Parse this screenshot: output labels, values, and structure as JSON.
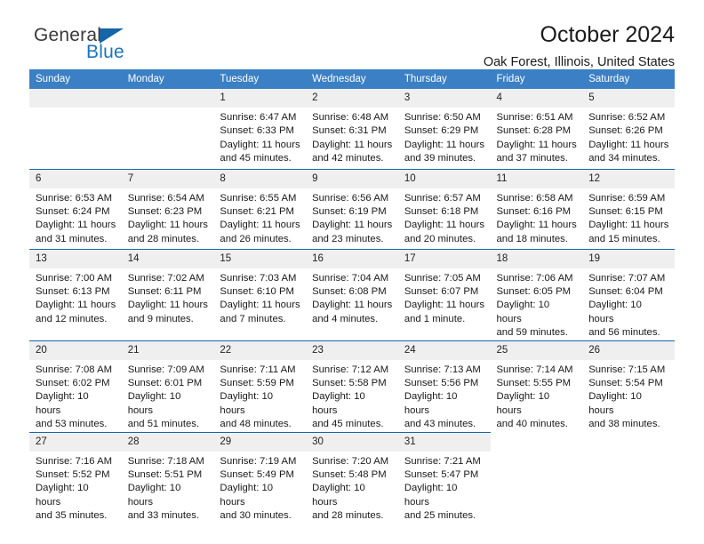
{
  "brand": {
    "name_part1": "General",
    "name_part2": "Blue",
    "triangle_color": "#1565a8",
    "blue_color": "#1b75bb"
  },
  "header": {
    "title": "October 2024",
    "subtitle": "Oak Forest, Illinois, United States"
  },
  "theme": {
    "header_row_bg": "#3b7fc4",
    "row_divider": "#1565a8",
    "daynum_bg": "#efefef"
  },
  "weekday_headers": [
    "Sunday",
    "Monday",
    "Tuesday",
    "Wednesday",
    "Thursday",
    "Friday",
    "Saturday"
  ],
  "labels": {
    "sunrise_prefix": "Sunrise:",
    "sunset_prefix": "Sunset:",
    "daylight_prefix": "Daylight:"
  },
  "weeks": [
    [
      {
        "day": "",
        "lines": []
      },
      {
        "day": "",
        "lines": []
      },
      {
        "day": "1",
        "lines": [
          "Sunrise: 6:47 AM",
          "Sunset: 6:33 PM",
          "Daylight: 11 hours",
          "and 45 minutes."
        ]
      },
      {
        "day": "2",
        "lines": [
          "Sunrise: 6:48 AM",
          "Sunset: 6:31 PM",
          "Daylight: 11 hours",
          "and 42 minutes."
        ]
      },
      {
        "day": "3",
        "lines": [
          "Sunrise: 6:50 AM",
          "Sunset: 6:29 PM",
          "Daylight: 11 hours",
          "and 39 minutes."
        ]
      },
      {
        "day": "4",
        "lines": [
          "Sunrise: 6:51 AM",
          "Sunset: 6:28 PM",
          "Daylight: 11 hours",
          "and 37 minutes."
        ]
      },
      {
        "day": "5",
        "lines": [
          "Sunrise: 6:52 AM",
          "Sunset: 6:26 PM",
          "Daylight: 11 hours",
          "and 34 minutes."
        ]
      }
    ],
    [
      {
        "day": "6",
        "lines": [
          "Sunrise: 6:53 AM",
          "Sunset: 6:24 PM",
          "Daylight: 11 hours",
          "and 31 minutes."
        ]
      },
      {
        "day": "7",
        "lines": [
          "Sunrise: 6:54 AM",
          "Sunset: 6:23 PM",
          "Daylight: 11 hours",
          "and 28 minutes."
        ]
      },
      {
        "day": "8",
        "lines": [
          "Sunrise: 6:55 AM",
          "Sunset: 6:21 PM",
          "Daylight: 11 hours",
          "and 26 minutes."
        ]
      },
      {
        "day": "9",
        "lines": [
          "Sunrise: 6:56 AM",
          "Sunset: 6:19 PM",
          "Daylight: 11 hours",
          "and 23 minutes."
        ]
      },
      {
        "day": "10",
        "lines": [
          "Sunrise: 6:57 AM",
          "Sunset: 6:18 PM",
          "Daylight: 11 hours",
          "and 20 minutes."
        ]
      },
      {
        "day": "11",
        "lines": [
          "Sunrise: 6:58 AM",
          "Sunset: 6:16 PM",
          "Daylight: 11 hours",
          "and 18 minutes."
        ]
      },
      {
        "day": "12",
        "lines": [
          "Sunrise: 6:59 AM",
          "Sunset: 6:15 PM",
          "Daylight: 11 hours",
          "and 15 minutes."
        ]
      }
    ],
    [
      {
        "day": "13",
        "lines": [
          "Sunrise: 7:00 AM",
          "Sunset: 6:13 PM",
          "Daylight: 11 hours",
          "and 12 minutes."
        ]
      },
      {
        "day": "14",
        "lines": [
          "Sunrise: 7:02 AM",
          "Sunset: 6:11 PM",
          "Daylight: 11 hours",
          "and 9 minutes."
        ]
      },
      {
        "day": "15",
        "lines": [
          "Sunrise: 7:03 AM",
          "Sunset: 6:10 PM",
          "Daylight: 11 hours",
          "and 7 minutes."
        ]
      },
      {
        "day": "16",
        "lines": [
          "Sunrise: 7:04 AM",
          "Sunset: 6:08 PM",
          "Daylight: 11 hours",
          "and 4 minutes."
        ]
      },
      {
        "day": "17",
        "lines": [
          "Sunrise: 7:05 AM",
          "Sunset: 6:07 PM",
          "Daylight: 11 hours",
          "and 1 minute."
        ]
      },
      {
        "day": "18",
        "lines": [
          "Sunrise: 7:06 AM",
          "Sunset: 6:05 PM",
          "Daylight: 10 hours",
          "and 59 minutes."
        ]
      },
      {
        "day": "19",
        "lines": [
          "Sunrise: 7:07 AM",
          "Sunset: 6:04 PM",
          "Daylight: 10 hours",
          "and 56 minutes."
        ]
      }
    ],
    [
      {
        "day": "20",
        "lines": [
          "Sunrise: 7:08 AM",
          "Sunset: 6:02 PM",
          "Daylight: 10 hours",
          "and 53 minutes."
        ]
      },
      {
        "day": "21",
        "lines": [
          "Sunrise: 7:09 AM",
          "Sunset: 6:01 PM",
          "Daylight: 10 hours",
          "and 51 minutes."
        ]
      },
      {
        "day": "22",
        "lines": [
          "Sunrise: 7:11 AM",
          "Sunset: 5:59 PM",
          "Daylight: 10 hours",
          "and 48 minutes."
        ]
      },
      {
        "day": "23",
        "lines": [
          "Sunrise: 7:12 AM",
          "Sunset: 5:58 PM",
          "Daylight: 10 hours",
          "and 45 minutes."
        ]
      },
      {
        "day": "24",
        "lines": [
          "Sunrise: 7:13 AM",
          "Sunset: 5:56 PM",
          "Daylight: 10 hours",
          "and 43 minutes."
        ]
      },
      {
        "day": "25",
        "lines": [
          "Sunrise: 7:14 AM",
          "Sunset: 5:55 PM",
          "Daylight: 10 hours",
          "and 40 minutes."
        ]
      },
      {
        "day": "26",
        "lines": [
          "Sunrise: 7:15 AM",
          "Sunset: 5:54 PM",
          "Daylight: 10 hours",
          "and 38 minutes."
        ]
      }
    ],
    [
      {
        "day": "27",
        "lines": [
          "Sunrise: 7:16 AM",
          "Sunset: 5:52 PM",
          "Daylight: 10 hours",
          "and 35 minutes."
        ]
      },
      {
        "day": "28",
        "lines": [
          "Sunrise: 7:18 AM",
          "Sunset: 5:51 PM",
          "Daylight: 10 hours",
          "and 33 minutes."
        ]
      },
      {
        "day": "29",
        "lines": [
          "Sunrise: 7:19 AM",
          "Sunset: 5:49 PM",
          "Daylight: 10 hours",
          "and 30 minutes."
        ]
      },
      {
        "day": "30",
        "lines": [
          "Sunrise: 7:20 AM",
          "Sunset: 5:48 PM",
          "Daylight: 10 hours",
          "and 28 minutes."
        ]
      },
      {
        "day": "31",
        "lines": [
          "Sunrise: 7:21 AM",
          "Sunset: 5:47 PM",
          "Daylight: 10 hours",
          "and 25 minutes."
        ]
      },
      {
        "day": "",
        "lines": []
      },
      {
        "day": "",
        "lines": []
      }
    ]
  ]
}
